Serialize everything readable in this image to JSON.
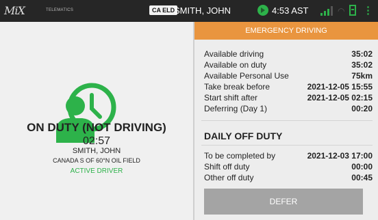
{
  "header": {
    "logo": "MiX",
    "logo_sub": "TELEMATICS",
    "eld_badge": "CA ELD",
    "driver_name": "SMITH, JOHN",
    "time": "4:53 AST",
    "icons": [
      "connection-status-icon",
      "signal-icon",
      "wifi-icon",
      "battery-icon",
      "menu-icon"
    ]
  },
  "status_panel": {
    "icon": "on-duty-clock-icon",
    "status": "ON DUTY (NOT DRIVING)",
    "duration": "02:57",
    "driver": "SMITH, JOHN",
    "ruleset": "CANADA S OF 60°N OIL FIELD",
    "active": "ACTIVE DRIVER"
  },
  "hours_panel": {
    "mode": "EMERGENCY DRIVING",
    "rows": [
      {
        "label": "Available driving",
        "value": "35:02"
      },
      {
        "label": "Available on duty",
        "value": "35:02"
      },
      {
        "label": "Available Personal Use",
        "value": "75km"
      },
      {
        "label": "Take break before",
        "value": "2021-12-05 15:55"
      },
      {
        "label": "Start shift after",
        "value": "2021-12-05 02:15"
      },
      {
        "label": "Deferring (Day 1)",
        "value": "00:20"
      }
    ],
    "section_title": "DAILY OFF DUTY",
    "off_rows": [
      {
        "label": "To be completed by",
        "value": "2021-12-03 17:00"
      },
      {
        "label": "Shift off duty",
        "value": "00:00"
      },
      {
        "label": "Other off duty",
        "value": "00:45"
      }
    ],
    "defer_label": "DEFER"
  },
  "colors": {
    "accent_green": "#2db24a",
    "emergency_orange": "#e9953f",
    "topbar": "#262626",
    "disabled_button": "#a4a4a4"
  }
}
